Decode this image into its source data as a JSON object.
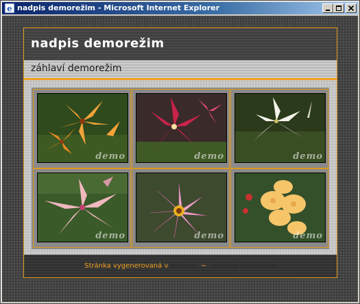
{
  "window": {
    "title": "nadpis demorežim - Microsoft Internet Explorer",
    "icon": "internet-explorer-icon",
    "controls": [
      "minimize-icon",
      "maximize-icon",
      "close-icon"
    ]
  },
  "page": {
    "header_title": "nadpis demorežim",
    "subheader": "záhlaví demorežim",
    "accent_color": "#f0a020",
    "thumbnails": [
      {
        "watermark": "demo",
        "subject": "orange lilies"
      },
      {
        "watermark": "demo",
        "subject": "red lily"
      },
      {
        "watermark": "demo",
        "subject": "white lily"
      },
      {
        "watermark": "demo",
        "subject": "pink lily"
      },
      {
        "watermark": "demo",
        "subject": "pink gazania"
      },
      {
        "watermark": "demo",
        "subject": "yellow gladiolus"
      }
    ],
    "footer": {
      "prefix": "Stránka vygenerovaná v",
      "link1": "XnView",
      "separator": "~",
      "link2": "šablony do XnView"
    }
  }
}
